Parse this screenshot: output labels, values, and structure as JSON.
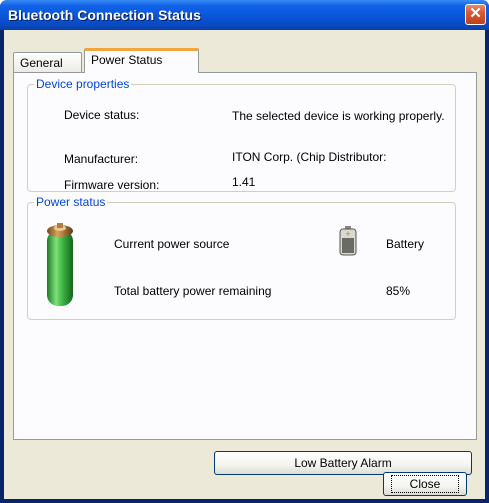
{
  "window": {
    "title": "Bluetooth Connection Status",
    "close_glyph": "✕"
  },
  "tabs": [
    {
      "label": "General",
      "active": false
    },
    {
      "label": "Power Status",
      "active": true
    }
  ],
  "device_properties": {
    "group_label": "Device properties",
    "status_label": "Device status:",
    "status_value": "The selected device is working properly.",
    "manufacturer_label": "Manufacturer:",
    "manufacturer_value": "ITON Corp. (Chip Distributor:",
    "firmware_label": "Firmware version:",
    "firmware_value": "1.41"
  },
  "power_status": {
    "group_label": "Power status",
    "source_label": "Current power source",
    "source_value": "Battery",
    "remaining_label": "Total battery power remaining",
    "remaining_value": "85%"
  },
  "buttons": {
    "alarm_label": "Low Battery Alarm",
    "close_label": "Close"
  },
  "icons": {
    "big_battery": "battery-icon",
    "small_battery": "battery-small-icon"
  },
  "colors": {
    "title_bar": "#0a55d8",
    "group_label": "#0046d5",
    "active_tab_accent": "#f2a53c",
    "battery_green": "#2fa13a"
  }
}
